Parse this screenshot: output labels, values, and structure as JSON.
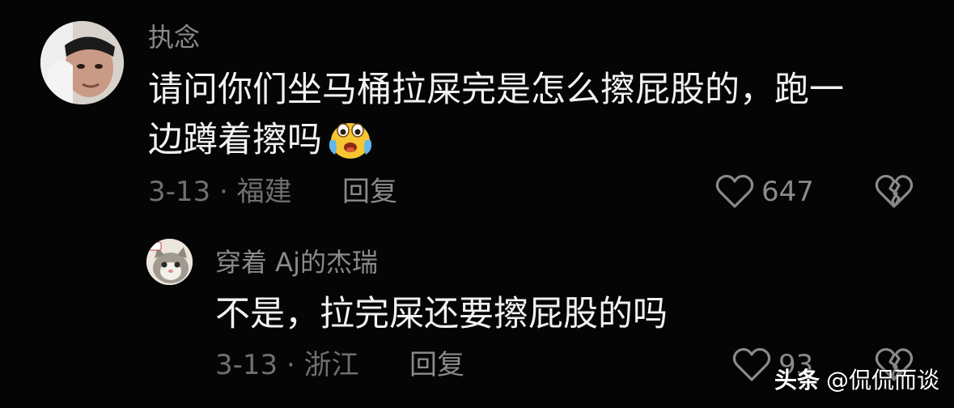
{
  "comment": {
    "username": "执念",
    "text_line1": "请问你们坐马桶拉屎完是怎么擦屁股的，跑一",
    "text_line2": "边蹲着擦吗",
    "emoji": "crying-laughing-emoji",
    "date_location": "3-13 · 福建",
    "reply_label": "回复",
    "like_count": "647"
  },
  "reply": {
    "username": "穿着 Aj的杰瑞",
    "text": "不是，拉完屎还要擦屁股的吗",
    "date_location": "3-13 · 浙江",
    "reply_label": "回复",
    "like_count": "93"
  },
  "watermark": {
    "brand": "头条",
    "account": "@侃侃而谈"
  },
  "icons": {
    "like": "heart-outline-icon",
    "dislike": "broken-heart-icon"
  },
  "colors": {
    "background": "#050505",
    "primary_text": "#f2f2f2",
    "secondary_text": "#8a8a8a"
  }
}
